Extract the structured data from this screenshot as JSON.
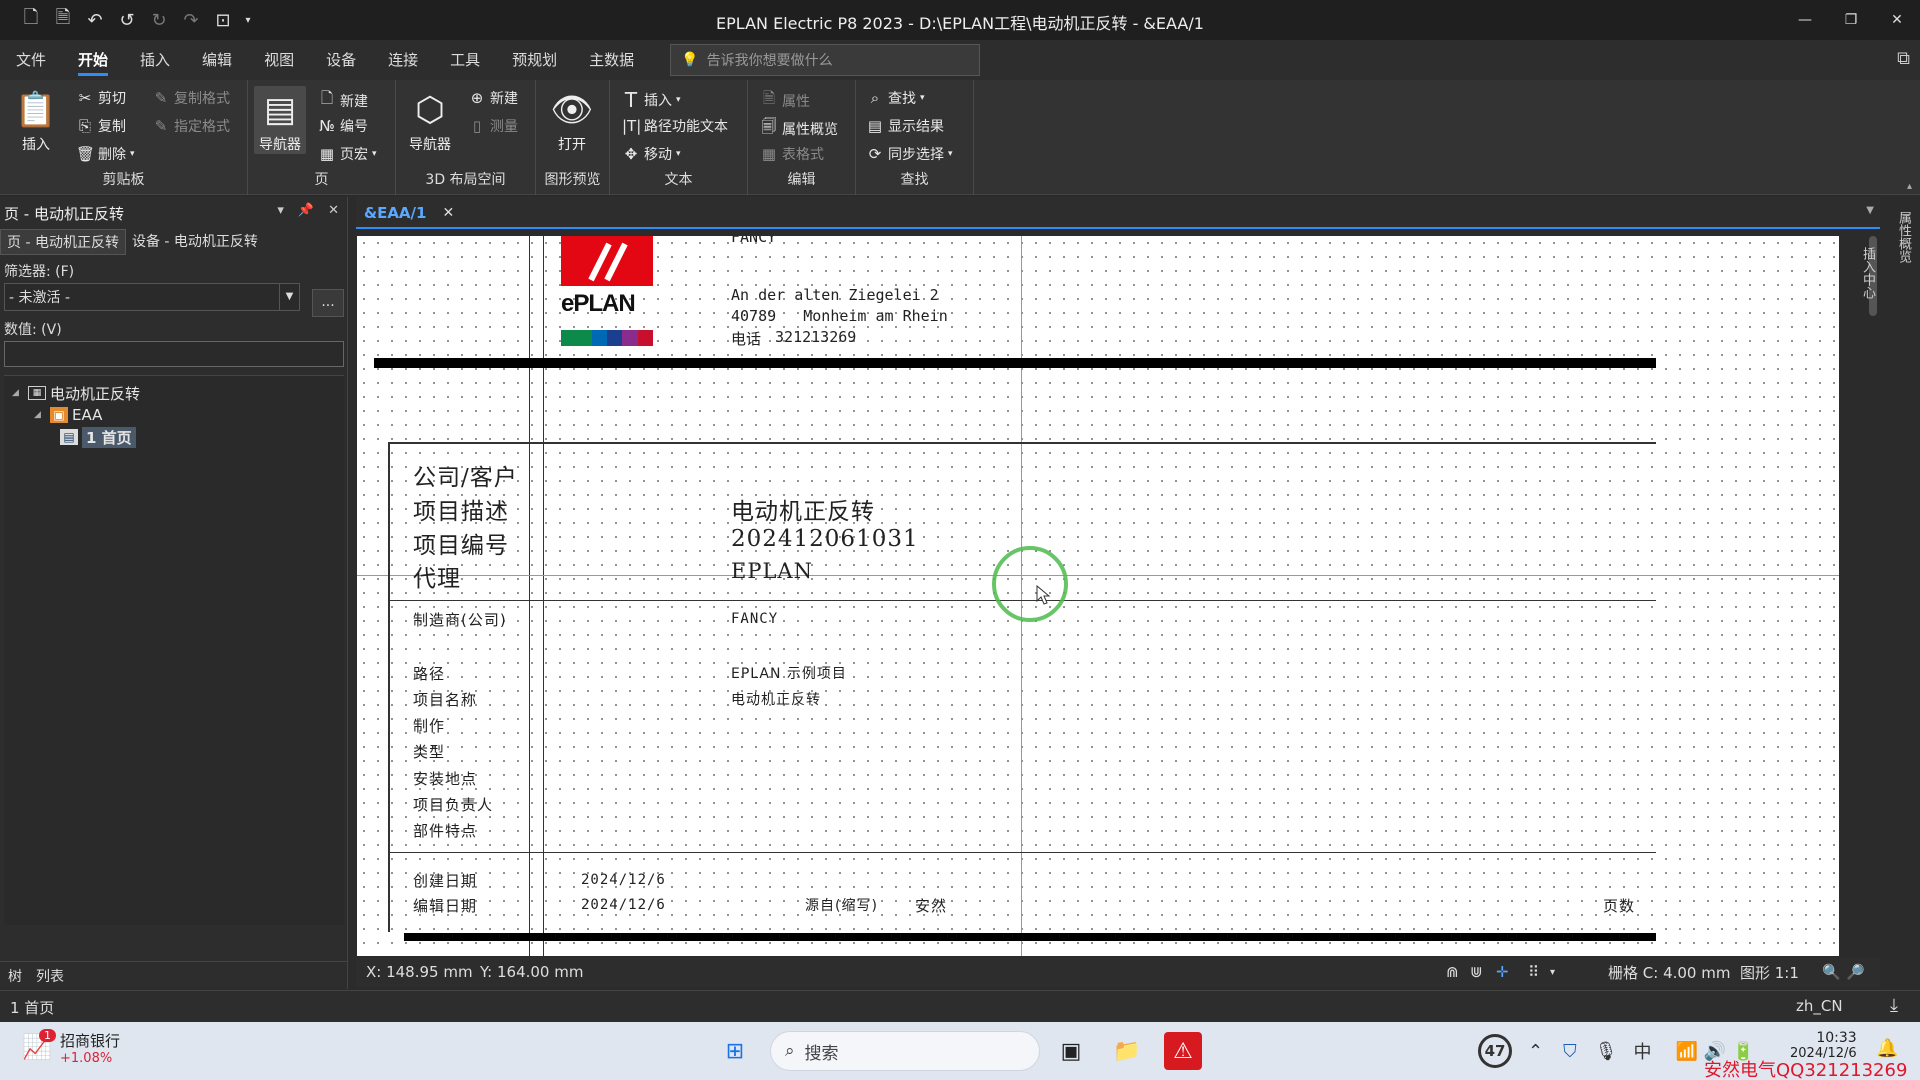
{
  "window": {
    "title": "EPLAN Electric P8 2023 - D:\\EPLAN工程\\电动机正反转 - &EAA/1"
  },
  "menu": {
    "tabs": [
      "文件",
      "开始",
      "插入",
      "编辑",
      "视图",
      "设备",
      "连接",
      "工具",
      "预规划",
      "主数据"
    ],
    "active": "开始",
    "tellme_placeholder": "告诉我你想要做什么"
  },
  "ribbon": {
    "clipboard": {
      "label": "剪贴板",
      "insert": "插入",
      "cut": "剪切",
      "copy": "复制",
      "delete": "删除",
      "copy_format": "复制格式",
      "assign_format": "指定格式"
    },
    "page": {
      "label": "页",
      "navigator": "导航器",
      "new": "新建",
      "number": "编号",
      "page_macro": "页宏"
    },
    "layout3d": {
      "label": "3D 布局空间",
      "navigator": "导航器",
      "new": "新建",
      "measure": "测量"
    },
    "preview": {
      "label": "图形预览",
      "open": "打开"
    },
    "text": {
      "label": "文本",
      "insert": "插入",
      "path_function_text": "路径功能文本",
      "move": "移动"
    },
    "edit": {
      "label": "编辑",
      "properties": "属性",
      "properties_overview": "属性概览",
      "table_format": "表格式"
    },
    "find": {
      "label": "查找",
      "find": "查找",
      "show_results": "显示结果",
      "sync_selection": "同步选择"
    }
  },
  "left_panel": {
    "title": "页 - 电动机正反转",
    "tabs": [
      "页 - 电动机正反转",
      "设备 - 电动机正反转"
    ],
    "filter_label": "筛选器: (F)",
    "filter_value": "- 未激活 -",
    "more_button": "...",
    "value_label": "数值: (V)",
    "tree": {
      "project": "电动机正反转",
      "structure": "EAA",
      "page": "1 首页"
    },
    "bottom_tabs": [
      "树",
      "列表"
    ]
  },
  "document": {
    "tab_label": "&EAA/1",
    "company_name_partial": "FANCY",
    "address_line1": "An der alten Ziegelei 2",
    "address_line2": "40789   Monheim am Rhein",
    "phone_label": "电话",
    "phone": "321213269",
    "logo_text": "ePLAN",
    "big_rows": [
      {
        "label": "公司/客户",
        "value": ""
      },
      {
        "label": "项目描述",
        "value": "电动机正反转"
      },
      {
        "label": "项目编号",
        "value": "202412061031"
      },
      {
        "label": "代理",
        "value": "EPLAN"
      }
    ],
    "manufacturer_label": "制造商(公司)",
    "manufacturer_value": "FANCY",
    "detail_rows": [
      {
        "label": "路径",
        "value": "EPLAN 示例项目"
      },
      {
        "label": "项目名称",
        "value": "电动机正反转"
      },
      {
        "label": "制作",
        "value": ""
      },
      {
        "label": "类型",
        "value": ""
      },
      {
        "label": "安装地点",
        "value": ""
      },
      {
        "label": "项目负责人",
        "value": ""
      },
      {
        "label": "部件特点",
        "value": ""
      }
    ],
    "created_label": "创建日期",
    "created_value": "2024/12/6",
    "edited_label": "编辑日期",
    "edited_value": "2024/12/6",
    "source_label": "源自(缩写)",
    "source_value": "安然",
    "pages_label": "页数"
  },
  "statusbar": {
    "x": "X: 148.95 mm",
    "y": "Y: 164.00 mm",
    "grid": "栅格 C: 4.00 mm",
    "scale": "图形 1:1",
    "locale": "zh_CN",
    "page": "1 首页"
  },
  "right_panel": {
    "properties": "属性概览",
    "insert_center": "插入中心"
  },
  "taskbar": {
    "stock_name": "招商银行",
    "stock_change": "+1.08%",
    "stock_badge": "1",
    "search_placeholder": "搜索",
    "badge_count": "47",
    "ime": "中",
    "time": "10:33",
    "date": "2024/12/6",
    "watermark": "安然电气QQ321213269"
  },
  "colors": {
    "accent": "#2f8bf5",
    "cursor_ring": "#4cbb4c",
    "logo_red": "#e30613"
  }
}
